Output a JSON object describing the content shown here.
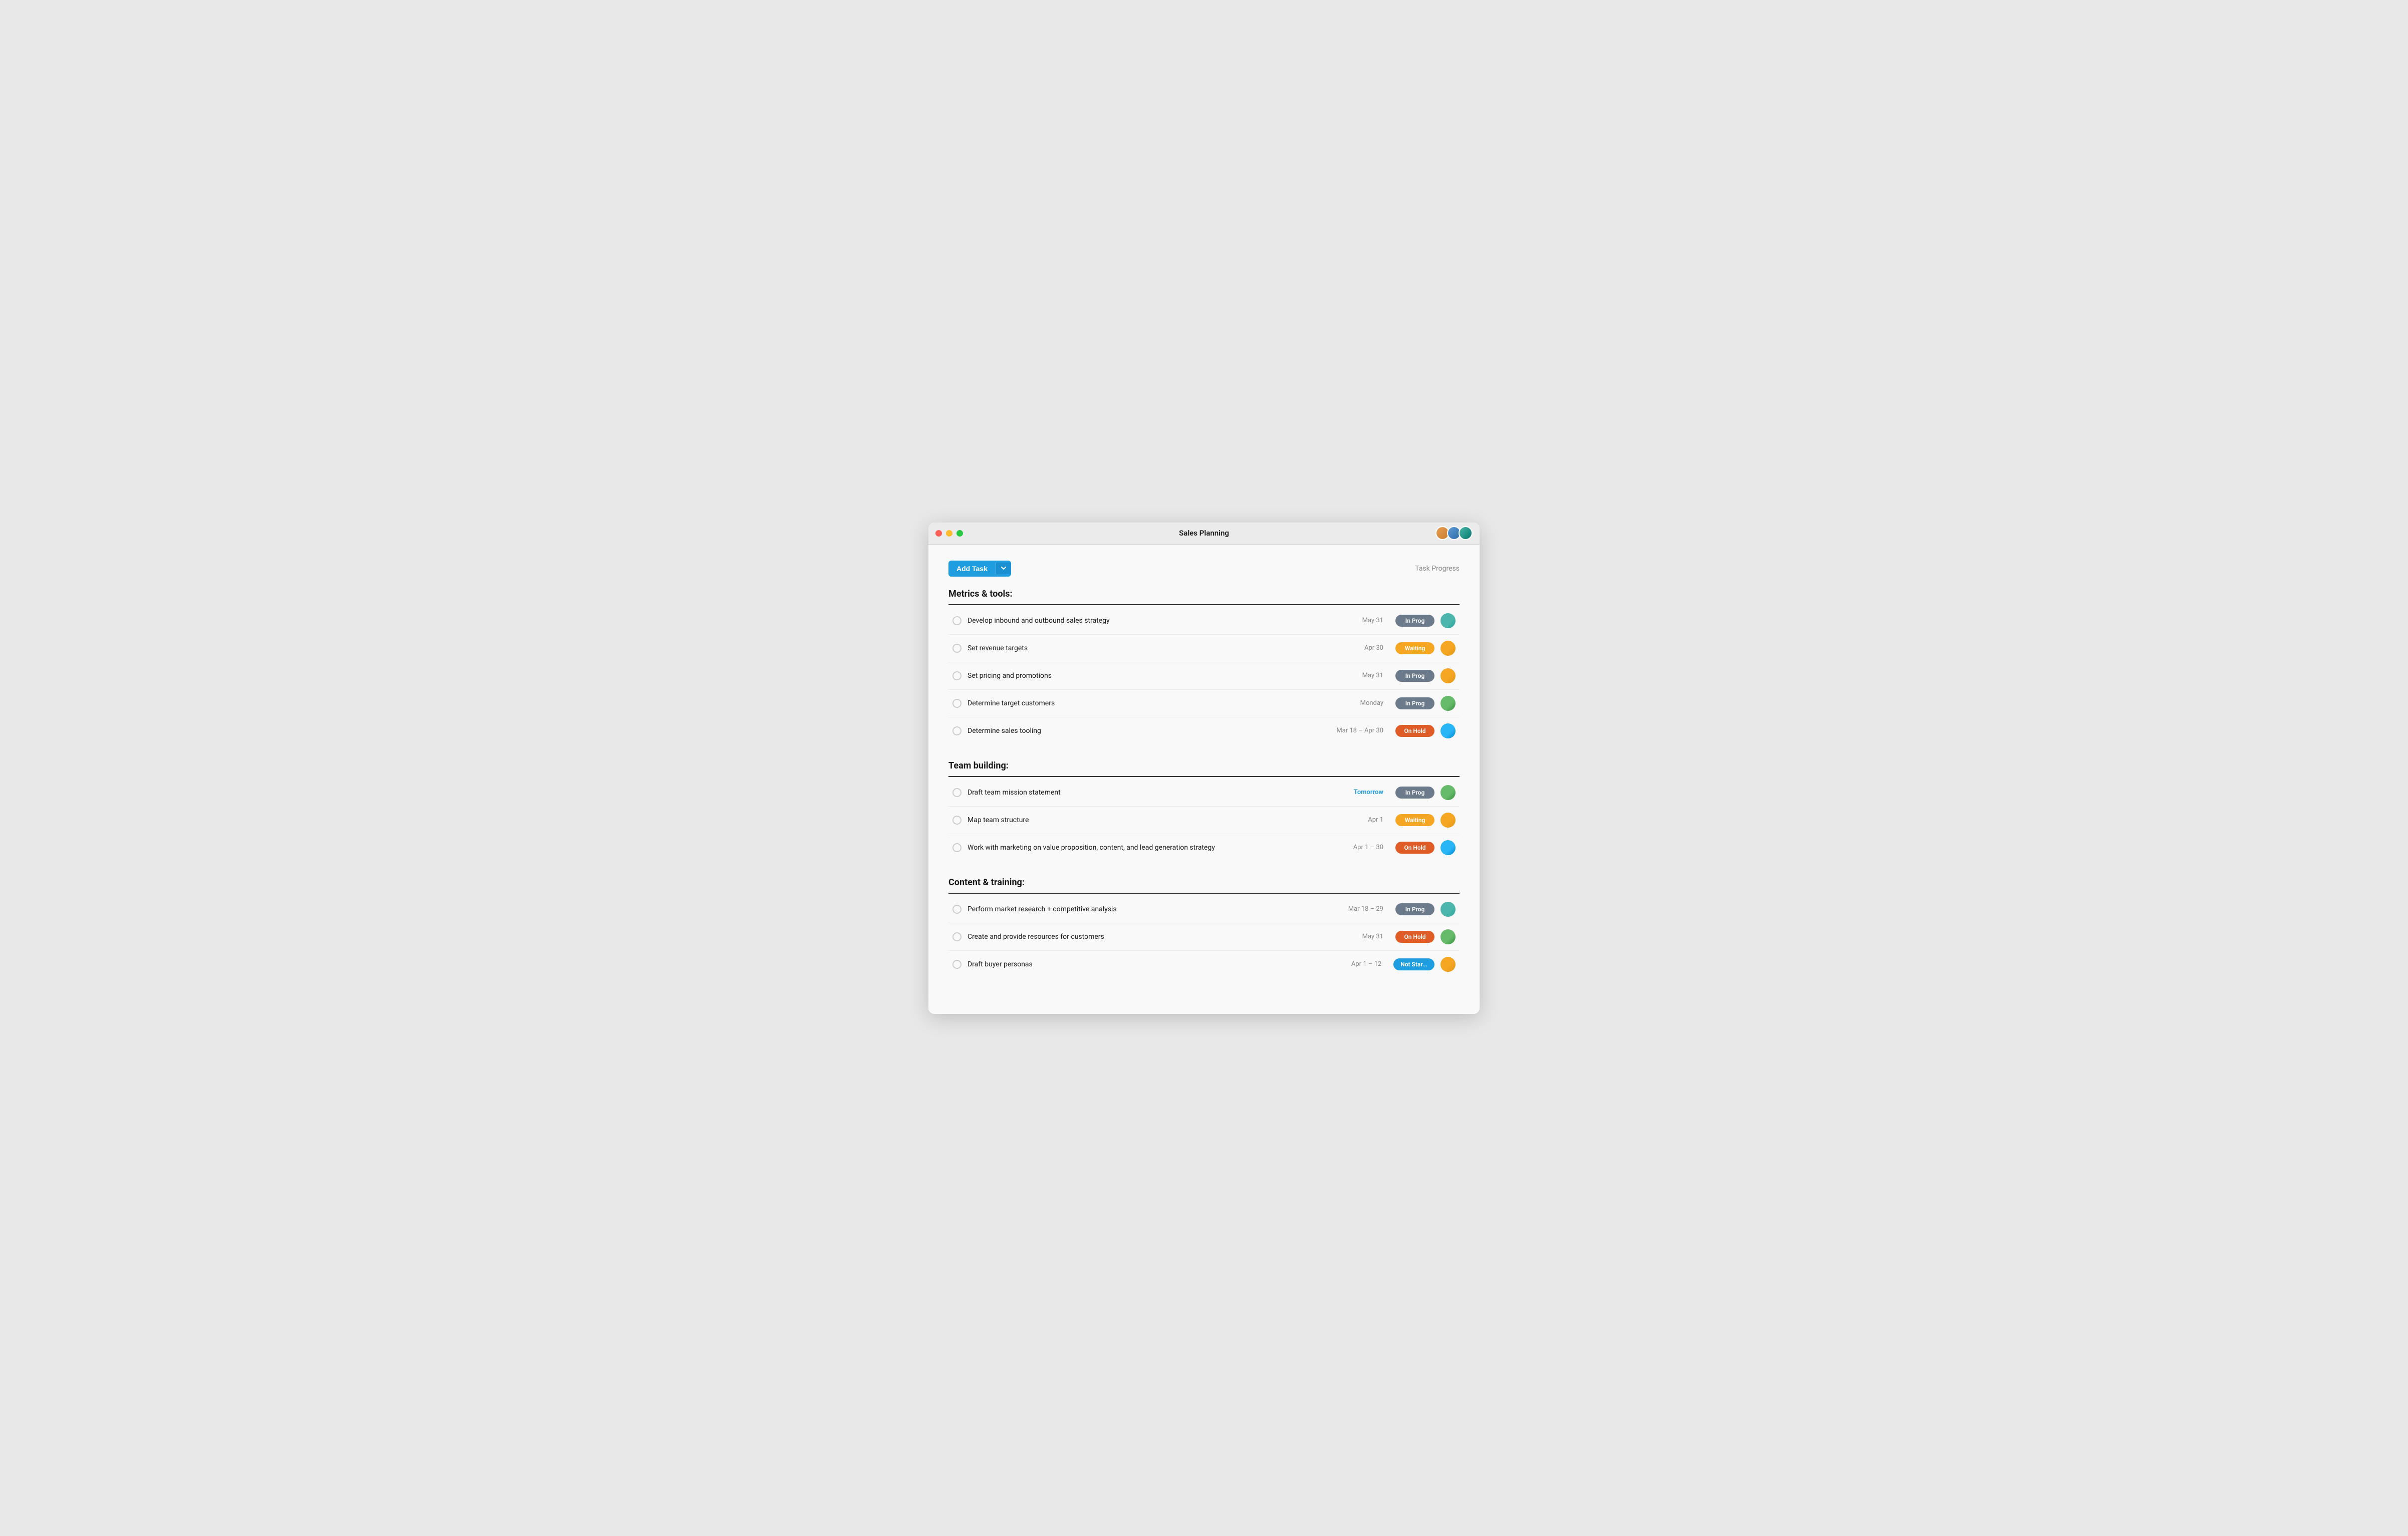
{
  "window": {
    "title": "Sales Planning"
  },
  "toolbar": {
    "add_task_label": "Add Task",
    "task_progress_label": "Task Progress"
  },
  "sections": [
    {
      "id": "metrics",
      "title": "Metrics & tools:",
      "tasks": [
        {
          "id": 1,
          "name": "Develop inbound and outbound sales strategy",
          "date": "May 31",
          "date_highlight": false,
          "status": "In Prog",
          "status_class": "badge-inprog",
          "avatar_class": "face-teal"
        },
        {
          "id": 2,
          "name": "Set revenue targets",
          "date": "Apr 30",
          "date_highlight": false,
          "status": "Waiting",
          "status_class": "badge-waiting",
          "avatar_class": "face-yellow"
        },
        {
          "id": 3,
          "name": "Set pricing and promotions",
          "date": "May 31",
          "date_highlight": false,
          "status": "In Prog",
          "status_class": "badge-inprog",
          "avatar_class": "face-yellow"
        },
        {
          "id": 4,
          "name": "Determine target customers",
          "date": "Monday",
          "date_highlight": false,
          "status": "In Prog",
          "status_class": "badge-inprog",
          "avatar_class": "face-green"
        },
        {
          "id": 5,
          "name": "Determine sales tooling",
          "date": "Mar 18 – Apr 30",
          "date_highlight": false,
          "status": "On Hold",
          "status_class": "badge-onhold",
          "avatar_class": "face-cyan"
        }
      ]
    },
    {
      "id": "team",
      "title": "Team building:",
      "tasks": [
        {
          "id": 6,
          "name": "Draft team mission statement",
          "date": "Tomorrow",
          "date_highlight": true,
          "status": "In Prog",
          "status_class": "badge-inprog",
          "avatar_class": "face-green"
        },
        {
          "id": 7,
          "name": "Map team structure",
          "date": "Apr 1",
          "date_highlight": false,
          "status": "Waiting",
          "status_class": "badge-waiting",
          "avatar_class": "face-yellow"
        },
        {
          "id": 8,
          "name": "Work with marketing on value proposition, content, and lead generation strategy",
          "date": "Apr 1 – 30",
          "date_highlight": false,
          "status": "On Hold",
          "status_class": "badge-onhold",
          "avatar_class": "face-cyan"
        }
      ]
    },
    {
      "id": "content",
      "title": "Content & training:",
      "tasks": [
        {
          "id": 9,
          "name": "Perform market research + competitive analysis",
          "date": "Mar 18 – 29",
          "date_highlight": false,
          "status": "In Prog",
          "status_class": "badge-inprog",
          "avatar_class": "face-teal"
        },
        {
          "id": 10,
          "name": "Create and provide resources for customers",
          "date": "May 31",
          "date_highlight": false,
          "status": "On Hold",
          "status_class": "badge-onhold",
          "avatar_class": "face-green"
        },
        {
          "id": 11,
          "name": "Draft buyer personas",
          "date": "Apr 1 – 12",
          "date_highlight": false,
          "status": "Not Star...",
          "status_class": "badge-notstar",
          "avatar_class": "face-yellow"
        }
      ]
    }
  ]
}
